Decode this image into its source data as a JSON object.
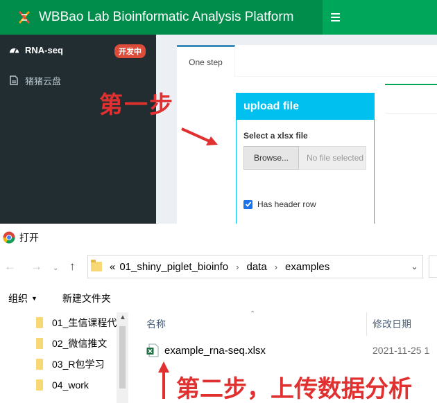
{
  "app": {
    "title": "WBBao Lab Bioinformatic Analysis Platform",
    "sidebar": {
      "items": [
        {
          "label": "RNA-seq",
          "badge": "开发中",
          "icon": "dashboard-icon"
        },
        {
          "label": "猪猪云盘",
          "icon": "file-icon"
        }
      ]
    },
    "tabs": [
      {
        "label": "One step"
      }
    ],
    "upload": {
      "header": "upload file",
      "file_label": "Select a xlsx file",
      "browse_label": "Browse...",
      "file_status": "No file selected",
      "checkbox_label": "Has header row",
      "checkbox_checked": true
    }
  },
  "annotations": {
    "step1": "第一步",
    "step2": "第二步，上传数据分析"
  },
  "dialog": {
    "title": "打开",
    "path": {
      "overflow": "«",
      "crumbs": [
        "01_shiny_piglet_bioinfo",
        "data",
        "examples"
      ]
    },
    "toolbar": {
      "organize": "组织",
      "new_folder": "新建文件夹"
    },
    "tree": [
      {
        "label": "01_生信课程代"
      },
      {
        "label": "02_微信推文"
      },
      {
        "label": "03_R包学习"
      },
      {
        "label": "04_work"
      }
    ],
    "columns": {
      "name": "名称",
      "date": "修改日期"
    },
    "files": [
      {
        "name": "example_rna-seq.xlsx",
        "date": "2021-11-25 1"
      }
    ]
  },
  "colors": {
    "brand": "#008d4c",
    "navbar": "#00a65a",
    "sidebar": "#222d32",
    "upload_header": "#00c0ef",
    "badge": "#dd4b39",
    "annotation": "#e03030"
  }
}
